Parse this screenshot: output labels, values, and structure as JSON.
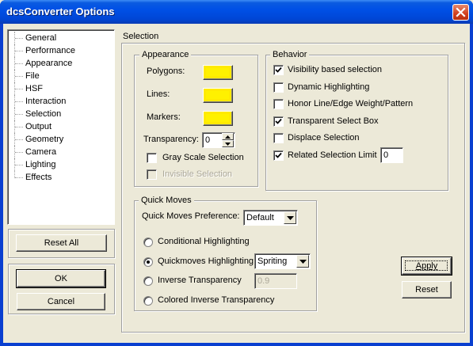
{
  "window": {
    "title": "dcsConverter Options"
  },
  "nav": {
    "items": [
      "General",
      "Performance",
      "Appearance",
      "File",
      "HSF",
      "Interaction",
      "Selection",
      "Output",
      "Geometry",
      "Camera",
      "Lighting",
      "Effects"
    ],
    "selected": "Selection"
  },
  "buttons": {
    "reset_all": "Reset All",
    "ok": "OK",
    "cancel": "Cancel",
    "apply": "Apply",
    "reset": "Reset"
  },
  "page": {
    "title": "Selection"
  },
  "appearance": {
    "legend": "Appearance",
    "polygons_label": "Polygons:",
    "lines_label": "Lines:",
    "markers_label": "Markers:",
    "swatch_color": "#fff100",
    "transparency_label": "Transparency:",
    "transparency_value": "0",
    "gray_scale_label": "Gray Scale Selection",
    "gray_scale_checked": false,
    "invisible_label": "Invisible Selection",
    "invisible_checked": false,
    "invisible_enabled": false
  },
  "behavior": {
    "legend": "Behavior",
    "options": [
      {
        "label": "Visibility based selection",
        "checked": true
      },
      {
        "label": "Dynamic Highlighting",
        "checked": false
      },
      {
        "label": "Honor Line/Edge Weight/Pattern",
        "checked": false
      },
      {
        "label": "Transparent Select Box",
        "checked": true
      },
      {
        "label": "Displace Selection",
        "checked": false
      },
      {
        "label": "Related Selection Limit",
        "checked": true
      }
    ],
    "limit_value": "0"
  },
  "quick_moves": {
    "legend": "Quick Moves",
    "preference_label": "Quick Moves Preference:",
    "preference_value": "Default",
    "options": [
      {
        "label": "Conditional Highlighting",
        "selected": false
      },
      {
        "label": "Quickmoves Highlighting",
        "selected": true
      },
      {
        "label": "Inverse Transparency",
        "selected": false
      },
      {
        "label": "Colored Inverse Transparency",
        "selected": false
      }
    ],
    "highlight_mode_value": "Spriting",
    "inverse_value": "0.9"
  }
}
